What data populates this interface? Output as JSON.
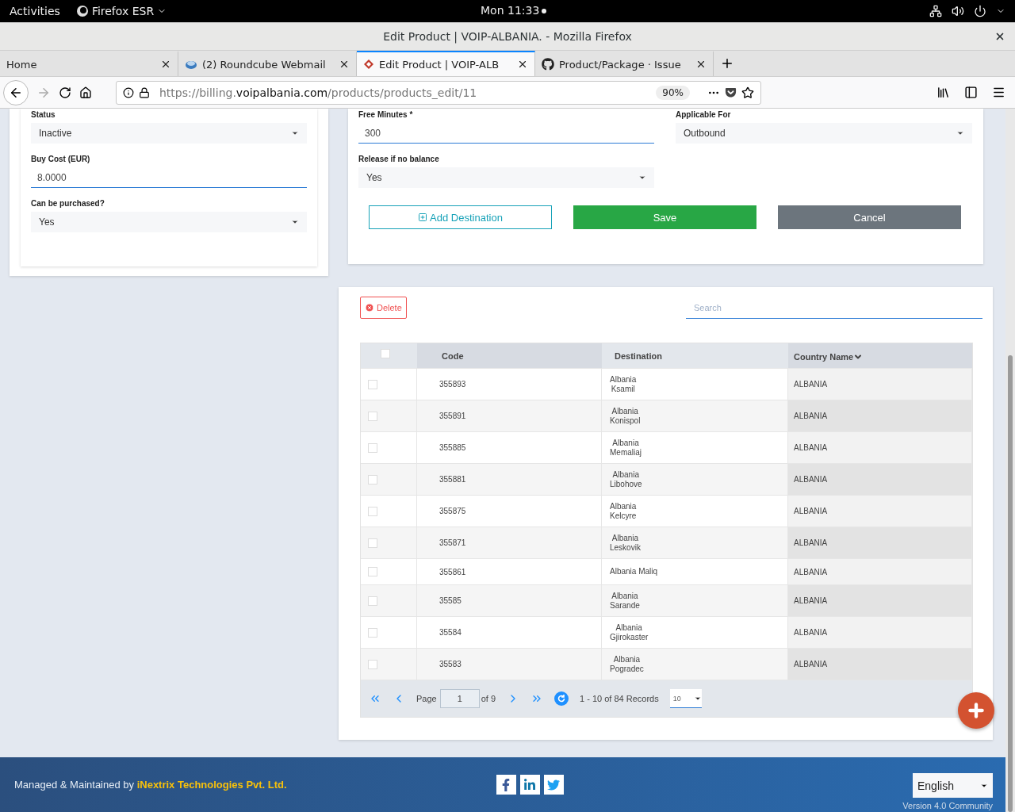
{
  "system_bar": {
    "activities": "Activities",
    "app_menu": "Firefox ESR",
    "clock": "Mon 11:33"
  },
  "window": {
    "title": "Edit Product | VOIP-ALBANIA. - Mozilla Firefox"
  },
  "tabs": [
    {
      "label": "Home",
      "kind": "plain",
      "selected": false
    },
    {
      "label": "(2) Roundcube Webmail",
      "kind": "mail",
      "selected": false
    },
    {
      "label": "Edit Product | VOIP-ALB",
      "kind": "app",
      "selected": true
    },
    {
      "label": "Product/Package · Issue",
      "kind": "github",
      "selected": false
    }
  ],
  "address_bar": {
    "url_prefix": "https://billing.",
    "url_domain": "voipalbania.com",
    "url_path": "/products/products_edit/11",
    "zoom": "90%"
  },
  "left_form": [
    {
      "label": "Status",
      "kind": "select",
      "value": "Inactive"
    },
    {
      "label": "Buy Cost (EUR)",
      "kind": "input",
      "value": "8.0000"
    },
    {
      "label": "Can be purchased?",
      "kind": "select",
      "value": "Yes"
    }
  ],
  "right_form": [
    {
      "label": "Free Minutes *",
      "kind": "input",
      "value": "300"
    },
    {
      "label": "Applicable For",
      "kind": "select",
      "value": "Outbound"
    },
    {
      "label": "Release if no balance",
      "kind": "select",
      "value": "Yes"
    }
  ],
  "actions": [
    {
      "label": "Add Destination",
      "kind": "outline"
    },
    {
      "label": "Save",
      "kind": "primary"
    },
    {
      "label": "Cancel",
      "kind": "secondary"
    }
  ],
  "destinations": {
    "delete": "Delete",
    "search_placeholder": "Search",
    "select_all_checked": false,
    "columns": [
      "Code",
      "Destination",
      "Country Name"
    ],
    "rows": [
      {
        "code": "355893",
        "destination": "Albania\nKsamil",
        "country": "ALBANIA",
        "checked": false
      },
      {
        "code": "355891",
        "destination": "Albania\nKonispol",
        "country": "ALBANIA",
        "checked": false
      },
      {
        "code": "355885",
        "destination": "Albania\nMemaliaj",
        "country": "ALBANIA",
        "checked": false
      },
      {
        "code": "355881",
        "destination": "Albania\nLibohove",
        "country": "ALBANIA",
        "checked": false
      },
      {
        "code": "355875",
        "destination": "Albania\nKelcyre",
        "country": "ALBANIA",
        "checked": false
      },
      {
        "code": "355871",
        "destination": "Albania\nLeskovik",
        "country": "ALBANIA",
        "checked": false
      },
      {
        "code": "355861",
        "destination": "Albania Maliq",
        "country": "ALBANIA",
        "checked": false
      },
      {
        "code": "35585",
        "destination": "Albania\nSarande",
        "country": "ALBANIA",
        "checked": false
      },
      {
        "code": "35584",
        "destination": "Albania\nGjirokaster",
        "country": "ALBANIA",
        "checked": false
      },
      {
        "code": "35583",
        "destination": "Albania\nPogradec",
        "country": "ALBANIA",
        "checked": false
      }
    ],
    "pager": {
      "page_label": "Page",
      "page": "1",
      "of": "of 9",
      "records": "1 - 10 of 84 Records",
      "page_size": "10"
    }
  },
  "footer": {
    "credit": "Managed & Maintained by **iNextrix Technologies Pvt. Ltd.**",
    "language": "English",
    "version": "Version 4.0 Community"
  }
}
